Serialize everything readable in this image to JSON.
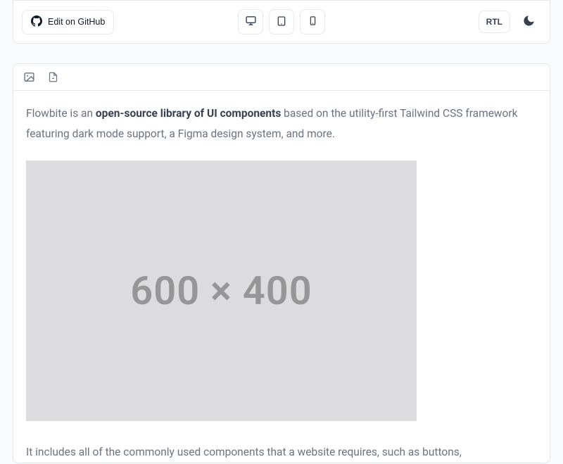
{
  "toolbar": {
    "edit_label": "Edit on GitHub",
    "rtl_label": "RTL"
  },
  "editor": {
    "para1_pre": "Flowbite is an ",
    "para1_bold": "open-source library of UI components",
    "para1_post": " based on the utility-first Tailwind CSS framework featuring dark mode support, a Figma design system, and more.",
    "placeholder_text": "600 × 400",
    "para2": "It includes all of the commonly used components that a website requires, such as buttons,"
  }
}
